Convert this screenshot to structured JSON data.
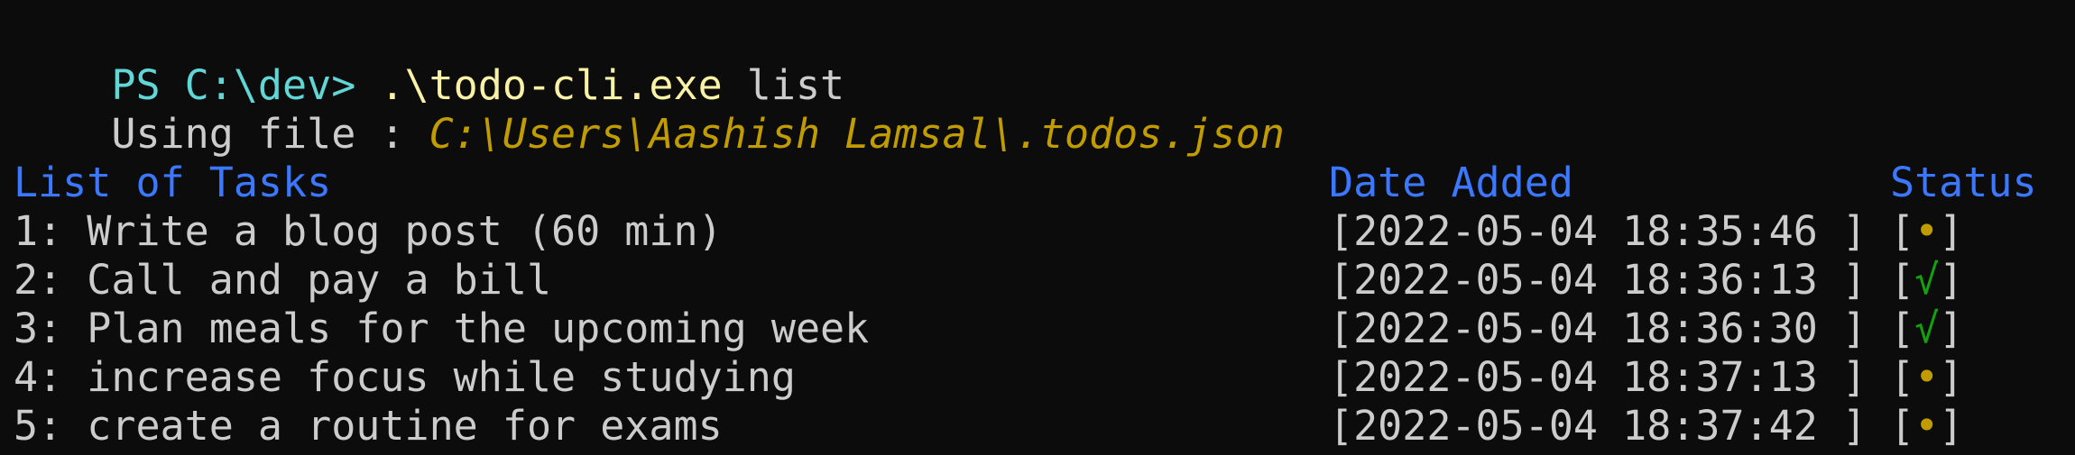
{
  "prompt": {
    "ps": "PS C:\\dev> ",
    "executable": ".\\todo-cli.exe",
    "argument": " list"
  },
  "file_info": {
    "label": "Using file : ",
    "path": "C:\\Users\\Aashish Lamsal\\.todos.json"
  },
  "table": {
    "headers": {
      "task": "List of Tasks",
      "date": "Date Added",
      "status": "Status"
    },
    "rows": [
      {
        "task": "1: Write a blog post (60 min)",
        "date": "[2022-05-04 18:35:46 ]",
        "status": "•",
        "done": false
      },
      {
        "task": "2: Call and pay a bill",
        "date": "[2022-05-04 18:36:13 ]",
        "status": "√",
        "done": true
      },
      {
        "task": "3: Plan meals for the upcoming week",
        "date": "[2022-05-04 18:36:30 ]",
        "status": "√",
        "done": true
      },
      {
        "task": "4: increase focus while studying",
        "date": "[2022-05-04 18:37:13 ]",
        "status": "•",
        "done": false
      },
      {
        "task": "5: create a routine for exams",
        "date": "[2022-05-04 18:37:42 ]",
        "status": "•",
        "done": false
      }
    ],
    "status_open": "[",
    "status_close": "]"
  },
  "colors": {
    "background": "#0c0c0c",
    "text": "#cccccc",
    "prompt": "#61d6d6",
    "executable": "#f9f1a5",
    "path": "#c19c00",
    "header": "#3b78ff",
    "done": "#13a10e",
    "pending": "#c19c00"
  }
}
